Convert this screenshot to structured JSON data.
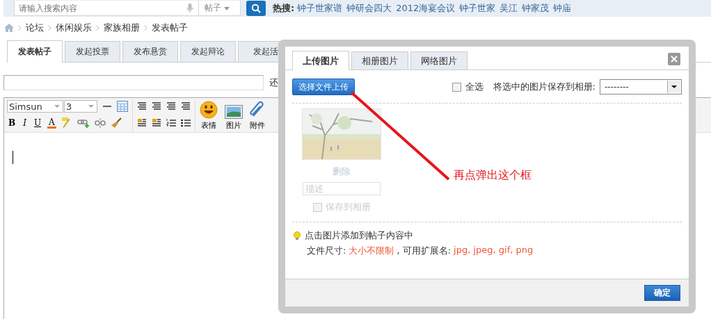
{
  "top_bar": {
    "search": {
      "placeholder": "请输入搜索内容"
    },
    "scope": "帖子",
    "hot_label": "热搜:",
    "hot_links": [
      "钟子世家谱",
      "钟研会四大",
      "2012海宴会议",
      "钟子世家",
      "吴江",
      "钟家茂",
      "钟庙"
    ]
  },
  "breadcrumb": [
    "论坛",
    "休闲娱乐",
    "家族相册",
    "发表帖子"
  ],
  "tabs": [
    {
      "label": "发表帖子",
      "selected": true
    },
    {
      "label": "发起投票",
      "selected": false
    },
    {
      "label": "发布悬赏",
      "selected": false
    },
    {
      "label": "发起辩论",
      "selected": false
    },
    {
      "label": "发起活",
      "selected": false
    }
  ],
  "title_hint": "还",
  "editor": {
    "font": "Simsun",
    "size": "3",
    "format_buttons": [
      "B",
      "I",
      "U",
      "A"
    ],
    "insert_buttons": [
      "表情",
      "图片",
      "附件"
    ]
  },
  "dialog": {
    "tabs": [
      {
        "label": "上传图片",
        "selected": true
      },
      {
        "label": "相册图片",
        "selected": false
      },
      {
        "label": "网络图片",
        "selected": false
      }
    ],
    "upload_button": "选择文件上传",
    "select_all": {
      "label": "全选",
      "checked": false
    },
    "save_label": "将选中的图片保存到相册:",
    "album": "--------",
    "photo": {
      "delete": "删除",
      "description_placeholder": "描述",
      "save_to_album": {
        "label": "保存到相册",
        "checked": false
      }
    },
    "hint": "点击图片添加到帖子内容中",
    "size_label": "文件尺寸:",
    "size_value": "大小不限制",
    "ext_label": ", 可用扩展名:",
    "ext_value": "jpg, jpeg, gif, png",
    "confirm": "确定"
  },
  "annotation": "再点弹出这个框"
}
